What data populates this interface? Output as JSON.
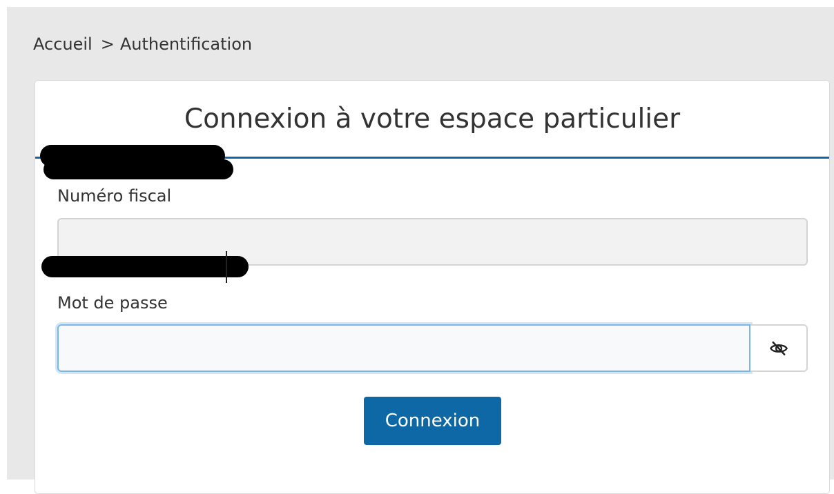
{
  "breadcrumb": {
    "home": "Accueil",
    "separator": ">",
    "current": "Authentification"
  },
  "card": {
    "title": "Connexion à votre espace particulier"
  },
  "form": {
    "fiscal_label": "Numéro fiscal",
    "fiscal_value": "",
    "password_label": "Mot de passe",
    "password_value": "",
    "toggle_icon": "eye-slash-icon",
    "submit_label": "Connexion"
  },
  "colors": {
    "accent": "#1565a6",
    "button": "#0f68a6",
    "focus_border": "#7cb6e8",
    "page_background": "#e8e8e8"
  }
}
